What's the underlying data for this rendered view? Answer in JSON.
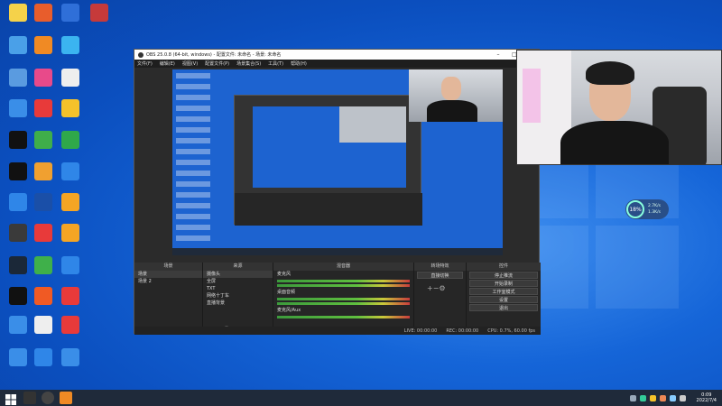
{
  "obs": {
    "title": "OBS 25.0.8 (64-bit, windows) - 配置文件: 未命名 - 场景: 未命名",
    "menu": [
      "文件(F)",
      "编辑(E)",
      "视图(V)",
      "配置文件(P)",
      "场景集合(S)",
      "工具(T)",
      "帮助(H)"
    ],
    "docks": {
      "scenes": {
        "header": "场景",
        "items": [
          "场景",
          "场景 2"
        ]
      },
      "sources": {
        "header": "来源",
        "items": [
          "摄像头",
          "全屏",
          "TXT",
          "网络十丁车",
          "直播背景"
        ]
      },
      "mixer": {
        "header": "混音器",
        "tracks": [
          "麦克风",
          "桌面音频",
          "麦克风/Aux"
        ]
      },
      "transitions": {
        "header": "转场特效",
        "value": "直接切换"
      },
      "controls": {
        "header": "控件",
        "buttons": [
          "停止推流",
          "开始录制",
          "工作室模式",
          "设置",
          "退出"
        ]
      }
    },
    "status": {
      "live": "LIVE: 00:00:00",
      "rec": "REC: 00:00:00",
      "cpu": "CPU: 0.7%, 60.00 fps"
    }
  },
  "perf_widget": {
    "percent": "18%",
    "up": "2.7K/s",
    "down": "1.3K/s"
  },
  "taskbar": {
    "time": "0:09",
    "date": "2022/7/4"
  },
  "colors": {
    "accent": "#1565d8",
    "obs_bg": "#2b2b2b"
  }
}
